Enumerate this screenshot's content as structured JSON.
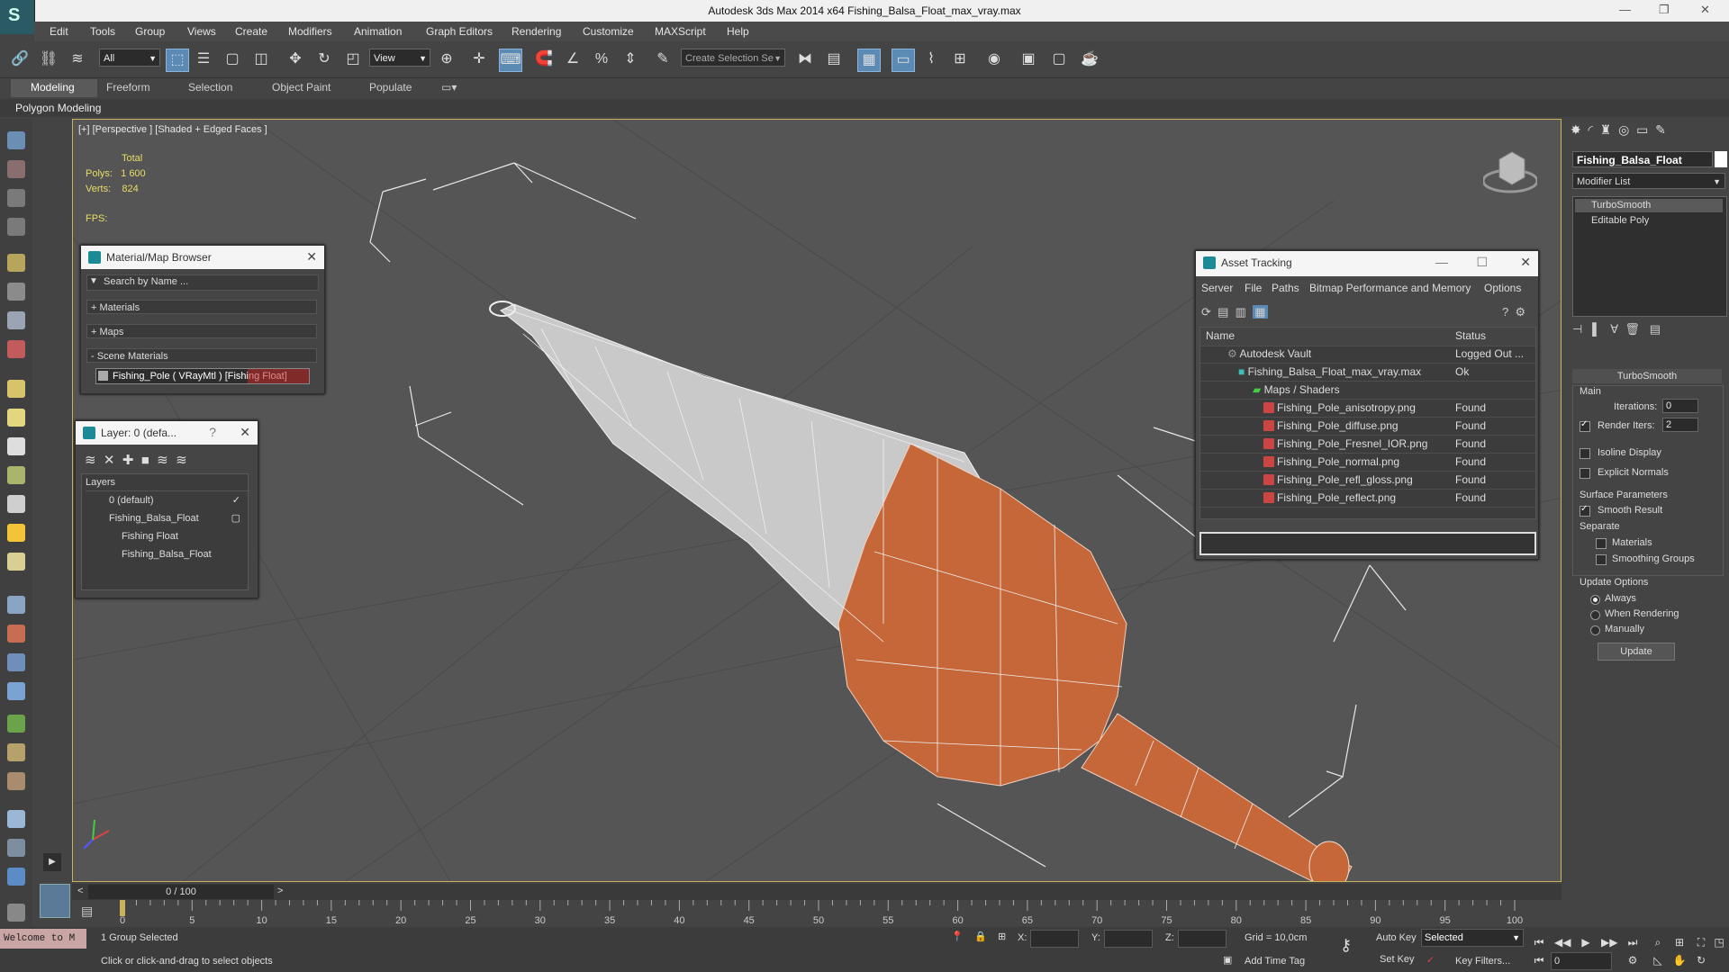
{
  "window": {
    "title": "Autodesk 3ds Max  2014 x64     Fishing_Balsa_Float_max_vray.max",
    "minimize": "—",
    "restore": "❐",
    "close": "✕"
  },
  "menu": [
    "Edit",
    "Tools",
    "Group",
    "Views",
    "Create",
    "Modifiers",
    "Animation",
    "Graph Editors",
    "Rendering",
    "Customize",
    "MAXScript",
    "Help"
  ],
  "toolbar": {
    "filter_value": "All",
    "refcoord_value": "View",
    "named_selection_placeholder": "Create Selection Se"
  },
  "ribbon": {
    "tabs": [
      "Modeling",
      "Freeform",
      "Selection",
      "Object Paint",
      "Populate"
    ],
    "subtitle": "Polygon Modeling"
  },
  "viewport": {
    "label": "[+] [Perspective ] [Shaded + Edged Faces ]",
    "stats": {
      "total_label": "Total",
      "polys_label": "Polys:",
      "polys": "1 600",
      "verts_label": "Verts:",
      "verts": "824",
      "fps_label": "FPS:"
    },
    "colors": {
      "body_white": "#c8c8c8",
      "body_orange": "#c8683a",
      "background": "#555555"
    }
  },
  "material_browser": {
    "title": "Material/Map Browser",
    "search_placeholder": "Search by Name ...",
    "sections": [
      "+ Materials",
      "+ Maps",
      "- Scene Materials"
    ],
    "scene_material": "Fishing_Pole  ( VRayMtl ) [Fishing Float]"
  },
  "layer_explorer": {
    "title": "Layer: 0 (defa...",
    "help": "?",
    "header": "Layers",
    "rows": [
      "0 (default)",
      "Fishing_Balsa_Float",
      "Fishing Float",
      "Fishing_Balsa_Float"
    ]
  },
  "asset_tracking": {
    "title": "Asset Tracking",
    "menu": [
      "Server",
      "File",
      "Paths",
      "Bitmap Performance and Memory",
      "Options"
    ],
    "col_name": "Name",
    "col_status": "Status",
    "rows": [
      {
        "name": "Autodesk Vault",
        "status": "Logged Out ..."
      },
      {
        "name": "Fishing_Balsa_Float_max_vray.max",
        "status": "Ok"
      },
      {
        "name": "Maps / Shaders",
        "status": ""
      },
      {
        "name": "Fishing_Pole_anisotropy.png",
        "status": "Found"
      },
      {
        "name": "Fishing_Pole_diffuse.png",
        "status": "Found"
      },
      {
        "name": "Fishing_Pole_Fresnel_IOR.png",
        "status": "Found"
      },
      {
        "name": "Fishing_Pole_normal.png",
        "status": "Found"
      },
      {
        "name": "Fishing_Pole_refl_gloss.png",
        "status": "Found"
      },
      {
        "name": "Fishing_Pole_reflect.png",
        "status": "Found"
      }
    ]
  },
  "command_panel": {
    "object_name": "Fishing_Balsa_Float",
    "modifier_list": "Modifier List",
    "stack": [
      "TurboSmooth",
      "Editable Poly"
    ],
    "rollout": "TurboSmooth",
    "main": "Main",
    "iterations_label": "Iterations:",
    "iterations": "0",
    "render_iters_label": "Render Iters:",
    "render_iters": "2",
    "isoline": "Isoline Display",
    "explicit": "Explicit Normals",
    "surface": "Surface Parameters",
    "smooth_result": "Smooth Result",
    "separate": "Separate",
    "materials": "Materials",
    "smoothing_groups": "Smoothing Groups",
    "update_options": "Update Options",
    "always": "Always",
    "when_rendering": "When Rendering",
    "manually": "Manually",
    "update_btn": "Update"
  },
  "timeline": {
    "frame": "0 / 100",
    "ticks": [
      "0",
      "5",
      "10",
      "15",
      "20",
      "25",
      "30",
      "35",
      "40",
      "45",
      "50",
      "55",
      "60",
      "65",
      "70",
      "75",
      "80",
      "85",
      "90",
      "95",
      "100"
    ]
  },
  "status": {
    "welcome": "Welcome to M",
    "selected": "1 Group Selected",
    "prompt": "Click or click-and-drag to select objects",
    "x_label": "X:",
    "y_label": "Y:",
    "z_label": "Z:",
    "grid": "Grid = 10,0cm",
    "add_time_tag": "Add Time Tag",
    "auto_key": "Auto Key",
    "set_key": "Set Key",
    "selected_dropdown": "Selected",
    "key_filters": "Key Filters...",
    "frame_field": "0"
  }
}
